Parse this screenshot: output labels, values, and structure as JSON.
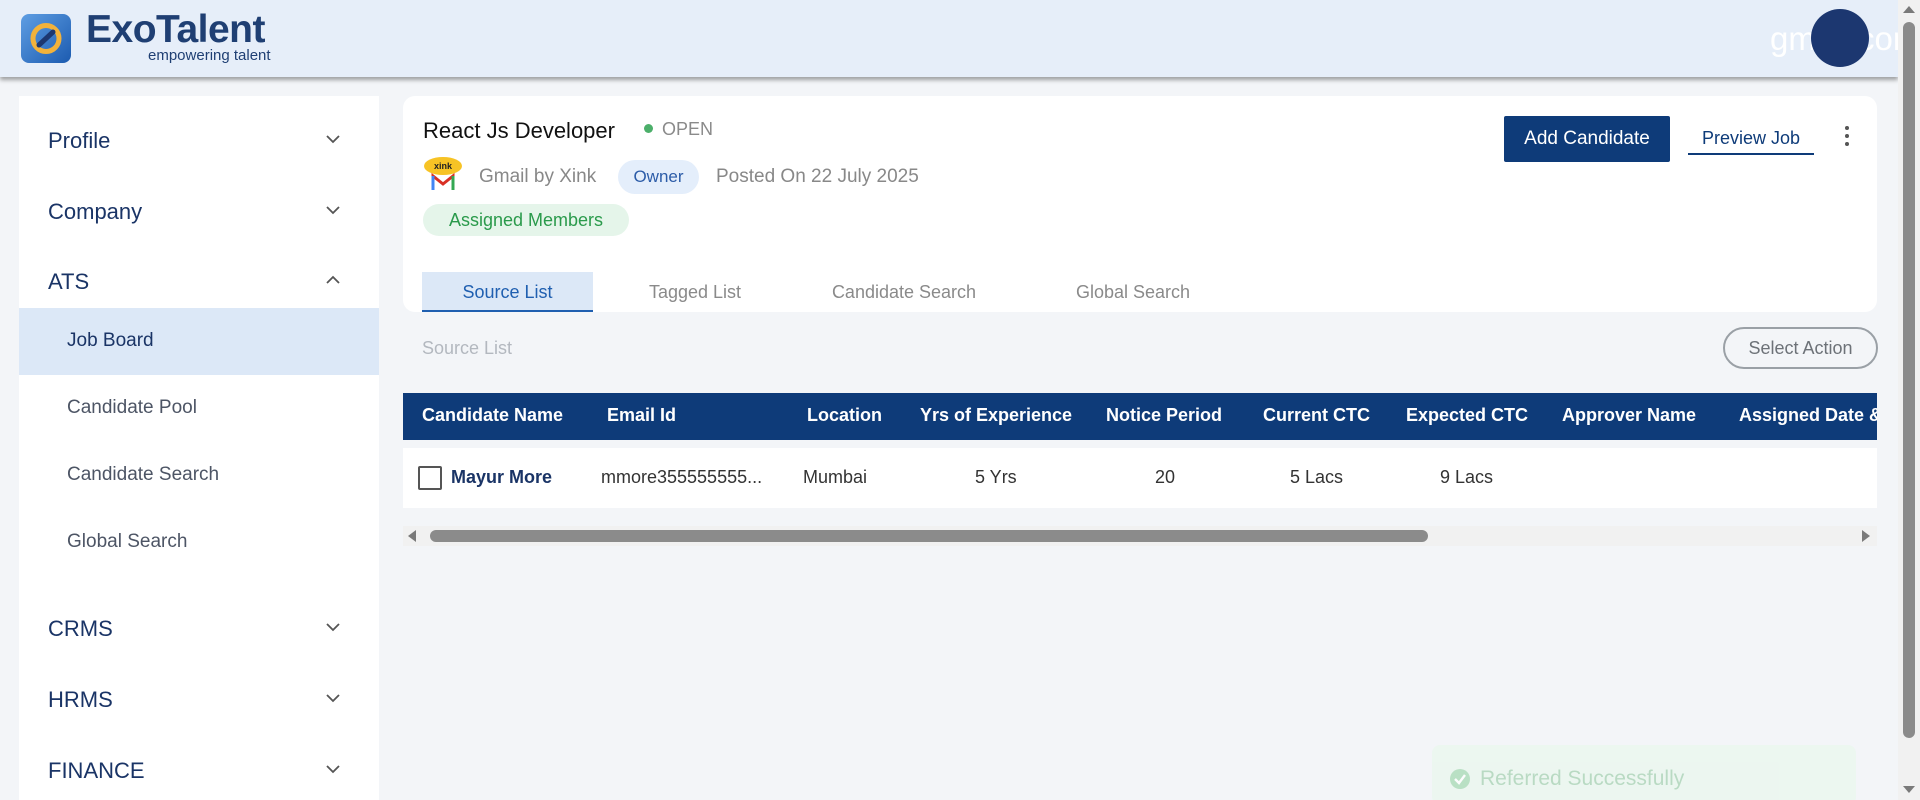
{
  "brand": {
    "name": "ExoTalent",
    "tagline": "empowering talent"
  },
  "header": {
    "user_text": "gmail.com"
  },
  "sidebar": {
    "groups": [
      {
        "label": "Profile",
        "expanded": false
      },
      {
        "label": "Company",
        "expanded": false
      },
      {
        "label": "ATS",
        "expanded": true
      },
      {
        "label": "CRMS",
        "expanded": false
      },
      {
        "label": "HRMS",
        "expanded": false
      },
      {
        "label": "FINANCE",
        "expanded": false
      }
    ],
    "ats_items": [
      {
        "label": "Job Board",
        "active": true
      },
      {
        "label": "Candidate Pool",
        "active": false
      },
      {
        "label": "Candidate Search",
        "active": false
      },
      {
        "label": "Global Search",
        "active": false
      }
    ]
  },
  "job": {
    "title": "React Js Developer",
    "status": "OPEN",
    "company": "Gmail by Xink",
    "role_badge": "Owner",
    "posted_on": "Posted On 22 July 2025",
    "assigned_members": "Assigned Members",
    "add_candidate_label": "Add Candidate",
    "preview_job_label": "Preview Job",
    "company_logo_text": "xink"
  },
  "tabs": [
    {
      "label": "Source List",
      "active": true
    },
    {
      "label": "Tagged List",
      "active": false
    },
    {
      "label": "Candidate Search",
      "active": false
    },
    {
      "label": "Global Search",
      "active": false
    }
  ],
  "source_list": {
    "section_label": "Source List",
    "select_action_label": "Select Action"
  },
  "table": {
    "columns": [
      "Candidate Name",
      "Email Id",
      "Location",
      "Yrs of Experience",
      "Notice Period",
      "Current CTC",
      "Expected CTC",
      "Approver Name",
      "Assigned Date &"
    ],
    "rows": [
      {
        "name": "Mayur More",
        "email": "mmore355555555...",
        "location": "Mumbai",
        "experience": "5 Yrs",
        "notice_period": "20",
        "current_ctc": "5 Lacs",
        "expected_ctc": "9 Lacs",
        "approver_name": "",
        "assigned_date": ""
      }
    ]
  },
  "toast": {
    "message": "Referred Successfully"
  },
  "colors": {
    "primary": "#0e3b79",
    "header_bg": "#e6eef9",
    "active_bg": "#dce8f7",
    "status_green": "#4caf6a"
  },
  "icons": {
    "chevron_down": "chevron-down-icon",
    "chevron_up": "chevron-up-icon",
    "kebab": "kebab-menu-icon",
    "check": "check-circle-icon"
  }
}
